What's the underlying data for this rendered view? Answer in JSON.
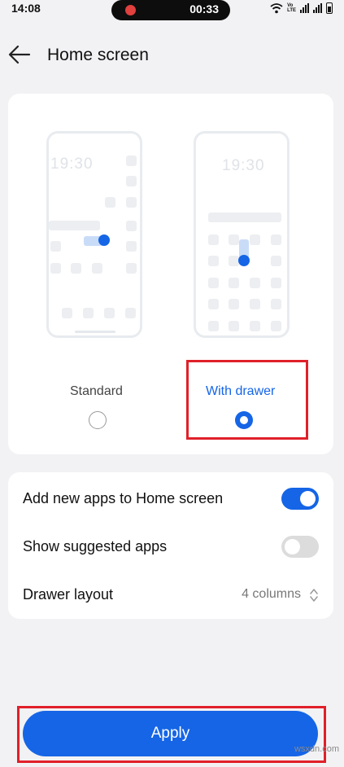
{
  "status_bar": {
    "time": "14:08",
    "recording_time": "00:33",
    "volte_line1": "Vo",
    "volte_line2": "LTE"
  },
  "header": {
    "title": "Home screen"
  },
  "layout_options": {
    "preview_clock": "19:30",
    "standard": {
      "label": "Standard",
      "selected": false
    },
    "with_drawer": {
      "label": "With drawer",
      "selected": true
    }
  },
  "settings": {
    "add_new_apps": {
      "label": "Add new apps to Home screen",
      "enabled": true
    },
    "show_suggested": {
      "label": "Show suggested apps",
      "enabled": false
    },
    "drawer_layout": {
      "label": "Drawer layout",
      "value": "4 columns"
    }
  },
  "apply_label": "Apply",
  "watermark": "wsxdn.com",
  "colors": {
    "accent": "#1565e6",
    "highlight": "#e0202a"
  }
}
